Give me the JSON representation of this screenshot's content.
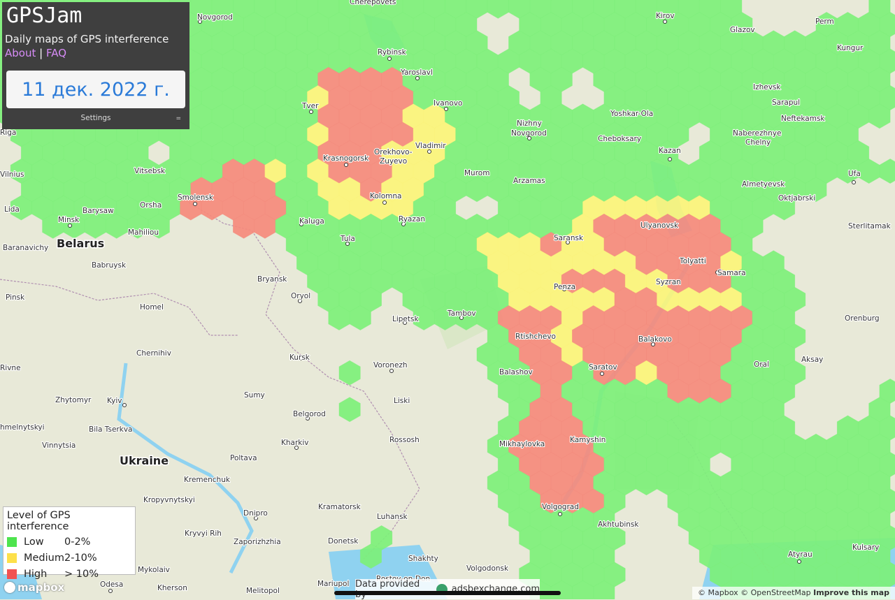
{
  "app": {
    "title": "GPSJam",
    "subtitle": "Daily maps of GPS interference",
    "link_about": "About",
    "link_separator": "|",
    "link_faq": "FAQ",
    "date": "11 дек. 2022 г.",
    "settings_label": "Settings"
  },
  "legend": {
    "title": "Level of GPS interference",
    "items": [
      {
        "label": "Low",
        "range": "0-2%",
        "color": "#4ee44e"
      },
      {
        "label": "Medium",
        "range": "2-10%",
        "color": "#fde04a"
      },
      {
        "label": "High",
        "range": "> 10%",
        "color": "#f25252"
      }
    ]
  },
  "colors": {
    "low": "#7df07a",
    "medium": "#fbf47a",
    "high": "#f58a7c",
    "land": "#e8e9d8",
    "water": "#8fd2f0",
    "forest": "#c8e2b4"
  },
  "map": {
    "countries": [
      "Belarus",
      "Ukraine"
    ],
    "cities": [
      "Novgorod",
      "Cherepovets",
      "Kirov",
      "Perm",
      "Glazov",
      "Kungur",
      "Rybinsk",
      "Yaroslavl",
      "Izhevsk",
      "Sarapul",
      "Neftekamsk",
      "Ivanovo",
      "Tver",
      "Yoshkar-Ola",
      "Nizhny Novgorod",
      "Cheboksary",
      "Naberezhnye Chelny",
      "Vladimir",
      "Orekhovo-Zuyevo",
      "Krasnogorsk",
      "Kazan",
      "Vitsebsk",
      "Murom",
      "Ufa",
      "Arzamas",
      "Almetyevsk",
      "Kolomna",
      "Oktjabrski",
      "Smolensk",
      "Orsha",
      "Barysaw",
      "Ryazan",
      "Kaluga",
      "Sterlitamak",
      "Minsk",
      "Mahiliou",
      "Saransk",
      "Ulyanovsk",
      "Tula",
      "Tolyatti",
      "Samara",
      "Baranavichy",
      "Babruysk",
      "Penza",
      "Syzran",
      "Bryansk",
      "Oryol",
      "Pinsk",
      "Tambov",
      "Homel",
      "Lipetsk",
      "Orenburg",
      "Rtishchevo",
      "Balakovo",
      "Chernihiv",
      "Kursk",
      "Voronezh",
      "Balashov",
      "Saratov",
      "Oral",
      "Aksay",
      "Rivne",
      "Zhytomyr",
      "Kyiv",
      "Sumy",
      "Liski",
      "Belgorod",
      "Bila Tserkva",
      "hmelnytskyi",
      "Rossosh",
      "Kamyshin",
      "Mikhaylovka",
      "Vinnytsia",
      "Kharkiv",
      "Poltava",
      "Kremenchuk",
      "Kropyvnytskyi",
      "Kramatorsk",
      "Volgograd",
      "Dnipro",
      "Luhansk",
      "Akhtubinsk",
      "Kryvyi Rih",
      "Zaporizhzhia",
      "Donetsk",
      "Atyrau",
      "Kulsary",
      "Shakhty",
      "Mykolaiv",
      "Volgodonsk",
      "Odesa",
      "Kherson",
      "Mariupol",
      "Melitopol",
      "Rostov-on-Don",
      "Lida",
      "Vilnius",
      "Riga"
    ]
  },
  "attribution": {
    "mapbox_logo": "mapbox",
    "mapbox": "© Mapbox",
    "osm": "© OpenStreetMap",
    "improve": "Improve this map",
    "provided_prefix": "Data provided by",
    "provided_source": "adsbexchange.com"
  }
}
